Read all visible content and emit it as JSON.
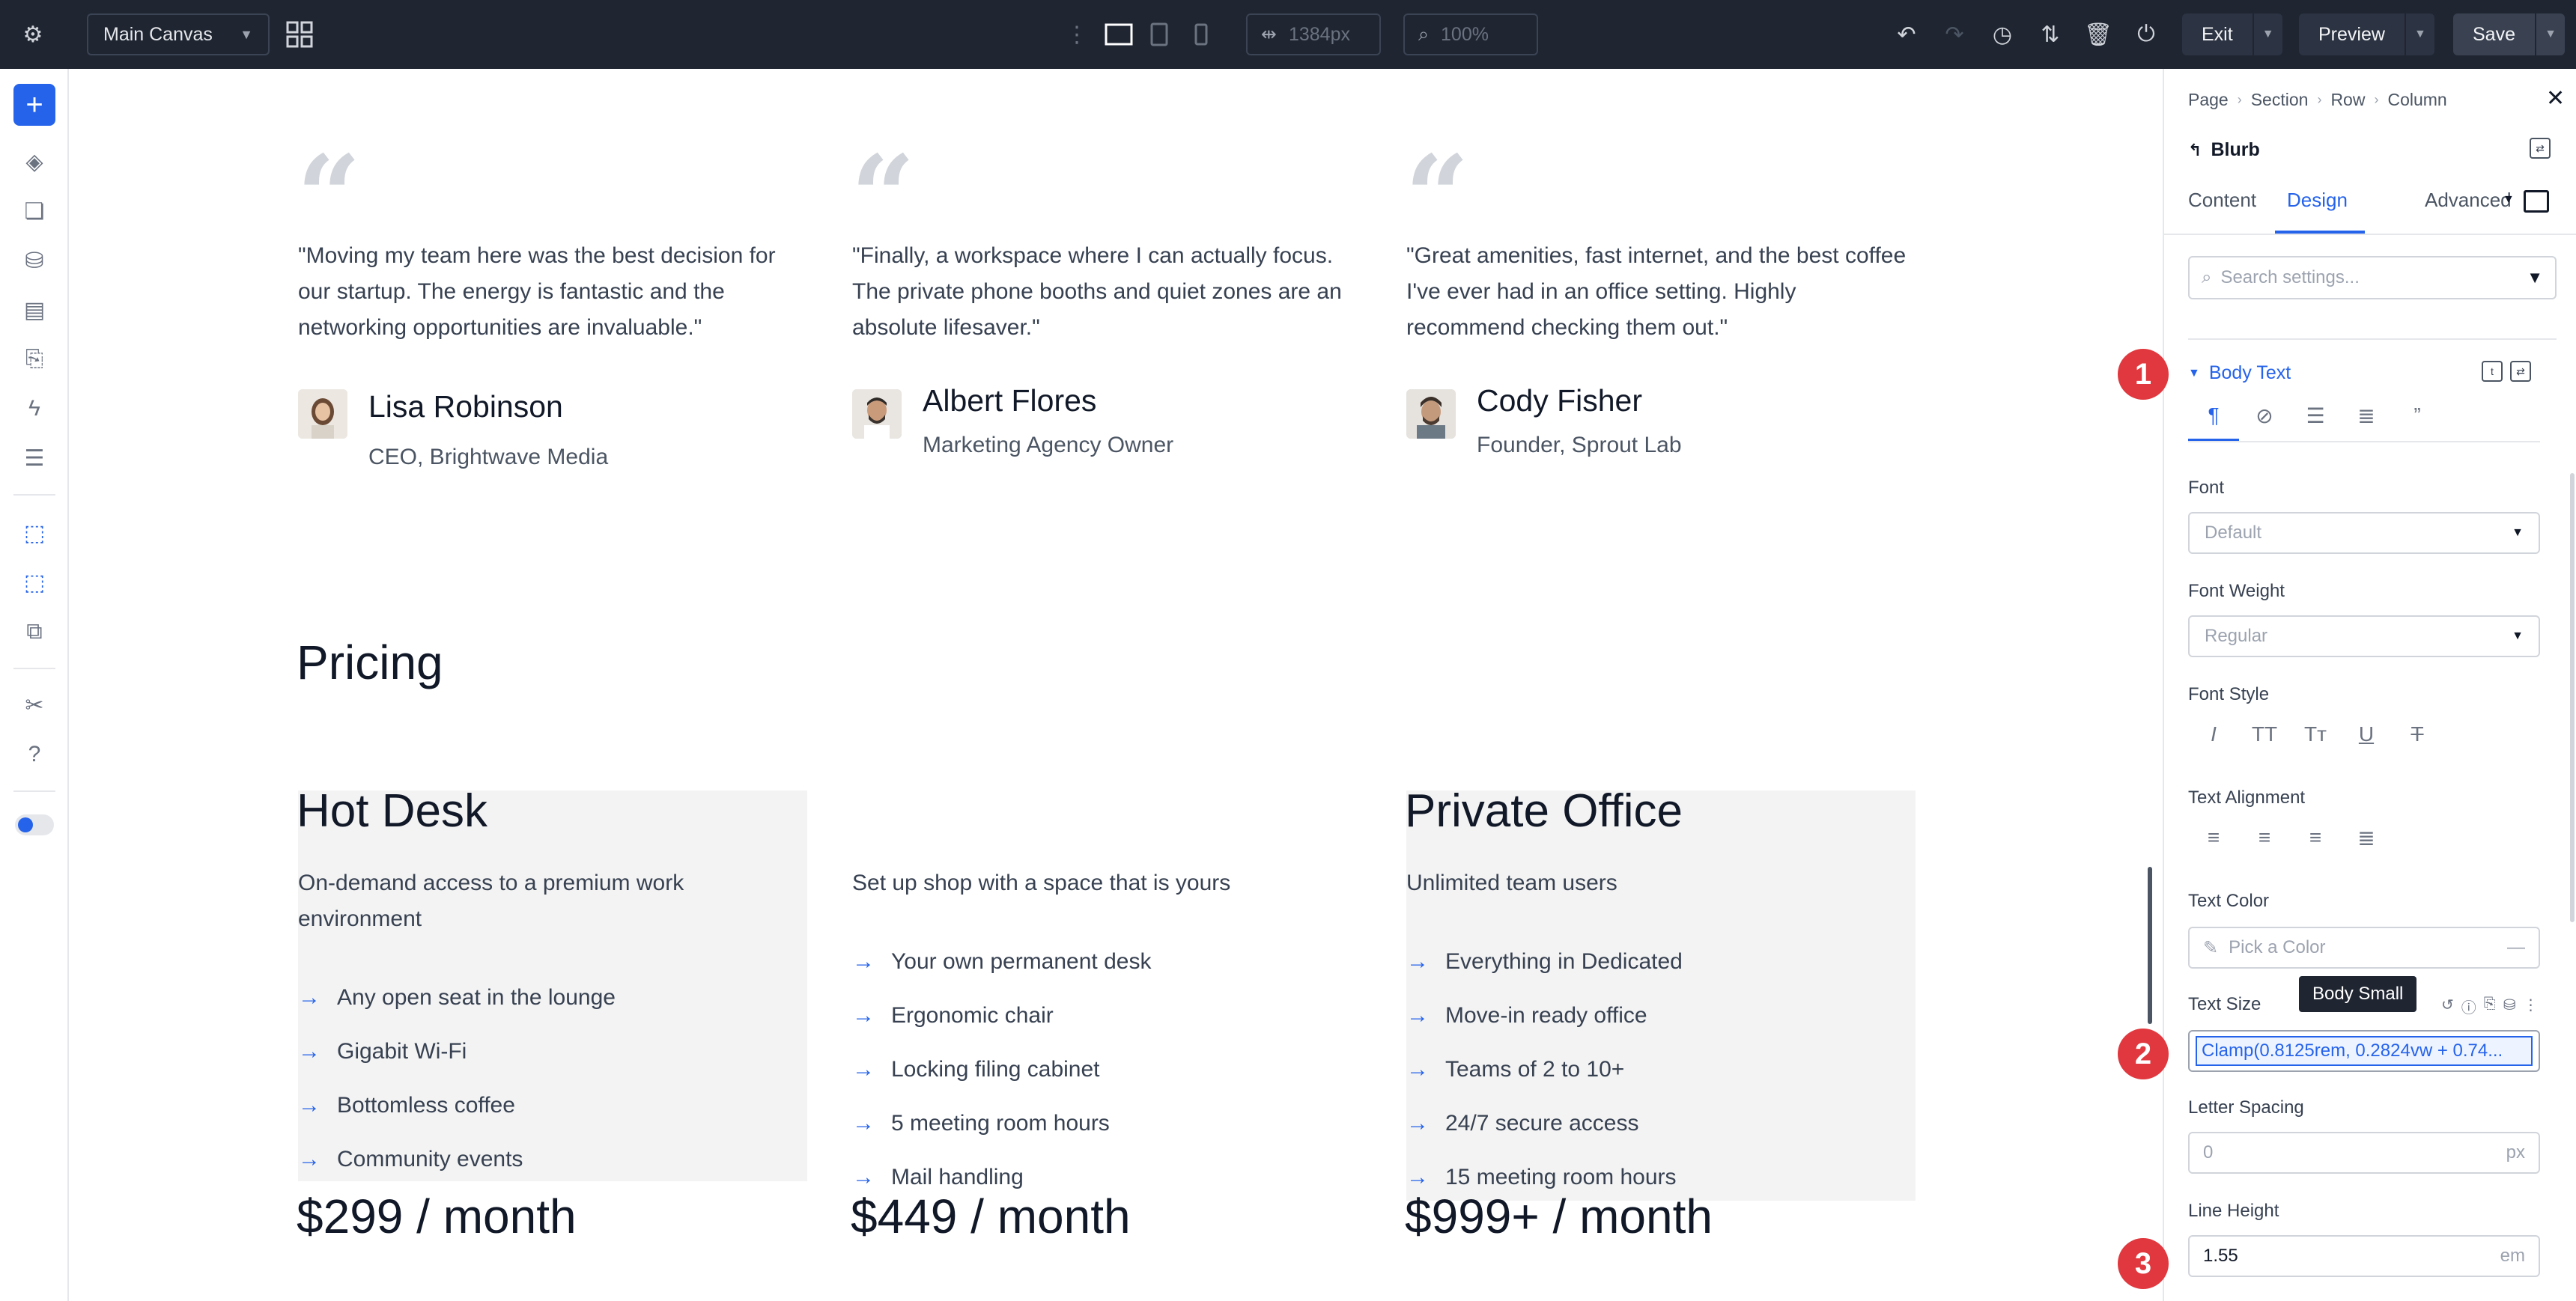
{
  "topbar": {
    "canvas_select": "Main Canvas",
    "width_value": "1384px",
    "zoom_value": "100%",
    "exit_label": "Exit",
    "preview_label": "Preview",
    "save_label": "Save"
  },
  "testimonials": [
    {
      "quote": "\"Moving my team here was the best decision for our startup. The energy is fantastic and the networking opportunities are invaluable.\"",
      "name": "Lisa Robinson",
      "role": "CEO, Brightwave Media"
    },
    {
      "quote": "\"Finally, a workspace where I can actually focus. The private phone booths and quiet zones are an absolute lifesaver.\"",
      "name": "Albert Flores",
      "role": "Marketing Agency Owner"
    },
    {
      "quote": "\"Great amenities, fast internet, and the best coffee I've ever had in an office setting. Highly recommend checking them out.\"",
      "name": "Cody Fisher",
      "role": "Founder, Sprout Lab"
    }
  ],
  "pricing": {
    "title": "Pricing",
    "plans": [
      {
        "title": "Hot Desk",
        "subtitle": "On-demand access to a premium work environment",
        "features": [
          "Any open seat in the lounge",
          "Gigabit Wi-Fi",
          "Bottomless coffee",
          "Community events"
        ],
        "price": "$299 / month"
      },
      {
        "title": "",
        "subtitle": "Set up shop with a space that is yours",
        "features": [
          "Your own permanent desk",
          "Ergonomic chair",
          "Locking filing cabinet",
          "5 meeting room hours",
          "Mail handling"
        ],
        "price": "$449 / month"
      },
      {
        "title": "Private Office",
        "subtitle": "Unlimited team users",
        "features": [
          "Everything in Dedicated",
          "Move-in ready office",
          "Teams of 2 to 10+",
          "24/7 secure access",
          "15 meeting room hours"
        ],
        "price": "$999+ / month"
      }
    ]
  },
  "panel": {
    "breadcrumb": [
      "Page",
      "Section",
      "Row",
      "Column"
    ],
    "module_title": "Blurb",
    "tabs": [
      "Content",
      "Design",
      "Advanced"
    ],
    "search_placeholder": "Search settings...",
    "group_title": "Body Text",
    "font_label": "Font",
    "font_value": "Default",
    "font_weight_label": "Font Weight",
    "font_weight_value": "Regular",
    "font_style_label": "Font Style",
    "text_alignment_label": "Text Alignment",
    "text_color_label": "Text Color",
    "text_color_placeholder": "Pick a Color",
    "text_size_label": "Text Size",
    "text_size_value": "Clamp(0.8125rem, 0.2824vw + 0.74...",
    "tooltip": "Body Small",
    "letter_spacing_label": "Letter Spacing",
    "letter_spacing_value": "0",
    "letter_spacing_unit": "px",
    "line_height_label": "Line Height",
    "line_height_value": "1.55",
    "line_height_unit": "em"
  },
  "badges": [
    "1",
    "2",
    "3"
  ]
}
